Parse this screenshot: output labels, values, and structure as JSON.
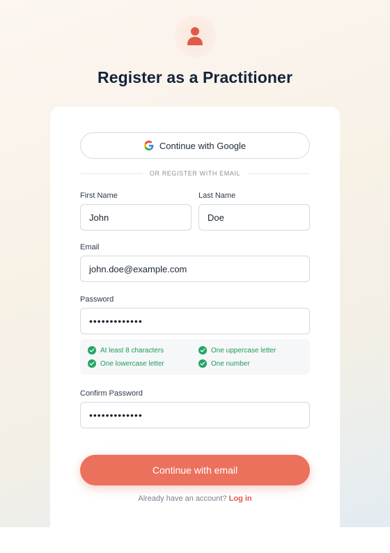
{
  "header": {
    "icon": "user-icon",
    "title": "Register as a Practitioner"
  },
  "oauth": {
    "google_label": "Continue with Google",
    "google_icon": "google-icon"
  },
  "divider": {
    "text": "OR REGISTER WITH EMAIL"
  },
  "form": {
    "first_name": {
      "label": "First Name",
      "value": "John"
    },
    "last_name": {
      "label": "Last Name",
      "value": "Doe"
    },
    "email": {
      "label": "Email",
      "value": "john.doe@example.com"
    },
    "password": {
      "label": "Password",
      "value": "•••••••••••••"
    },
    "confirm_password": {
      "label": "Confirm Password",
      "value": "•••••••••••••"
    }
  },
  "requirements": [
    {
      "text": "At least 8 characters",
      "met": true
    },
    {
      "text": "One uppercase letter",
      "met": true
    },
    {
      "text": "One lowercase letter",
      "met": true
    },
    {
      "text": "One number",
      "met": true
    }
  ],
  "submit_label": "Continue with email",
  "footer": {
    "prompt": "Already have an account?",
    "link": "Log in"
  },
  "colors": {
    "accent": "#ec715d",
    "success": "#22a563",
    "title": "#13233a"
  }
}
